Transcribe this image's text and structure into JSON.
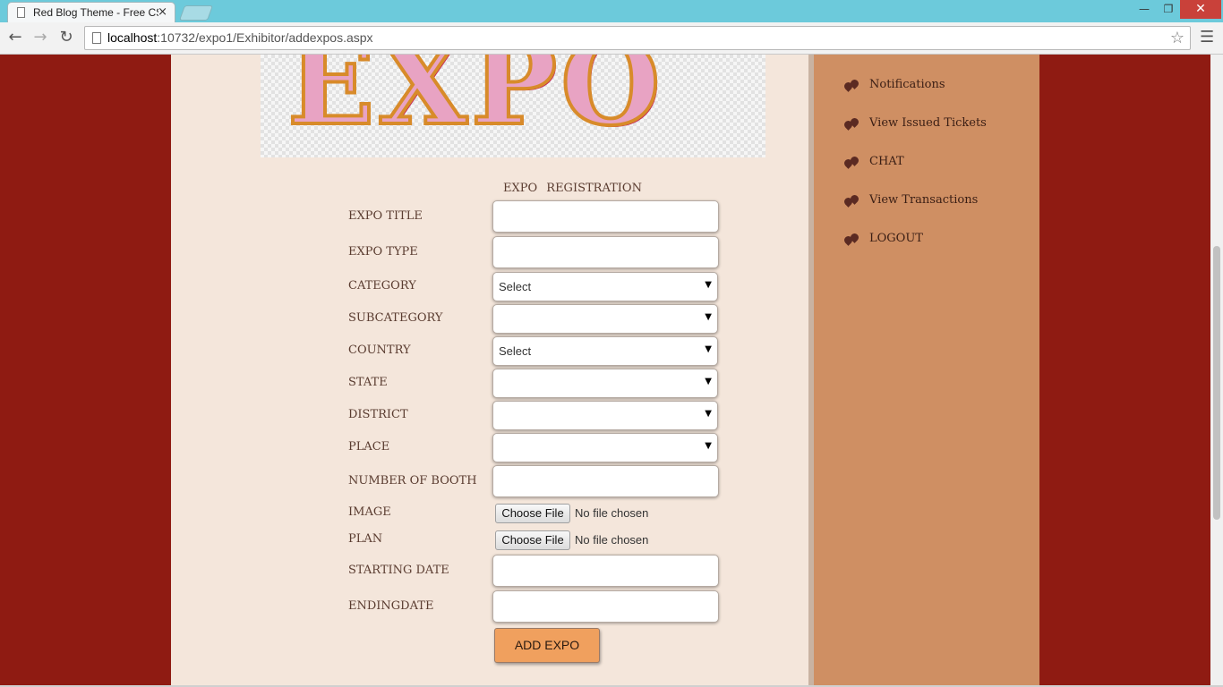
{
  "browser": {
    "tab_title": "Red Blog Theme - Free CS",
    "tab_close": "×",
    "url_host": "localhost",
    "url_path": ":10732/expo1/Exhibitor/addexpos.aspx"
  },
  "banner": {
    "text": "EXPO"
  },
  "form": {
    "heading": "EXPO  REGISTRATION",
    "fields": [
      {
        "label": "EXPO TITLE"
      },
      {
        "label": "EXPO TYPE"
      },
      {
        "label": "CATEGORY",
        "selected": "Select"
      },
      {
        "label": "SUBCATEGORY",
        "selected": ""
      },
      {
        "label": "COUNTRY",
        "selected": "Select"
      },
      {
        "label": "STATE",
        "selected": ""
      },
      {
        "label": "DISTRICT",
        "selected": ""
      },
      {
        "label": "PLACE",
        "selected": ""
      },
      {
        "label": "NUMBER OF BOOTH"
      },
      {
        "label": "IMAGE"
      },
      {
        "label": "PLAN"
      },
      {
        "label": "STARTING DATE"
      },
      {
        "label": "ENDINGDATE"
      }
    ],
    "file_button_label": "Choose File",
    "no_file_text": "No file chosen",
    "submit_label": "ADD EXPO"
  },
  "sidebar": {
    "items": [
      {
        "label": "Notifications"
      },
      {
        "label": "View Issued Tickets"
      },
      {
        "label": "CHAT"
      },
      {
        "label": "View Transactions"
      },
      {
        "label": "LOGOUT"
      }
    ]
  }
}
